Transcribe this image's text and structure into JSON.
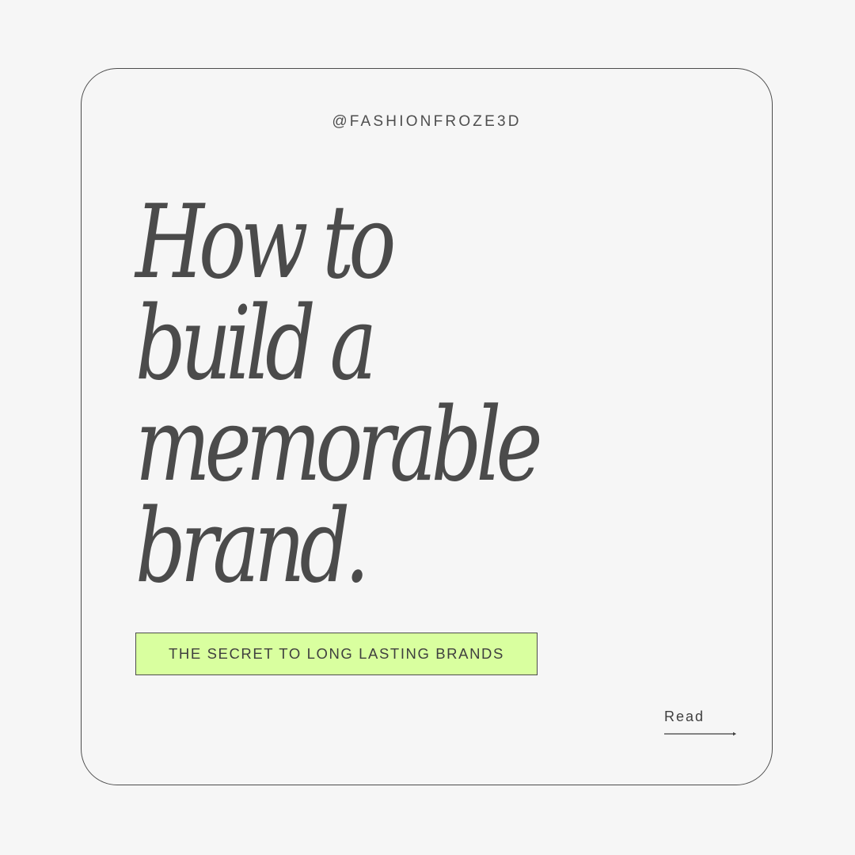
{
  "card": {
    "handle": "@FASHIONFROZE3D",
    "headline": {
      "lines": [
        "How to",
        "build a",
        "memorable",
        "brand."
      ]
    },
    "tagline": "THE SECRET TO LONG LASTING BRANDS",
    "read_link": {
      "label": "Read",
      "icon": "arrow-right-icon"
    }
  },
  "colors": {
    "background": "#f6f6f6",
    "text": "#4b4b4b",
    "tagline_fill": "#d9ff9f",
    "border": "#4d4d4d"
  }
}
